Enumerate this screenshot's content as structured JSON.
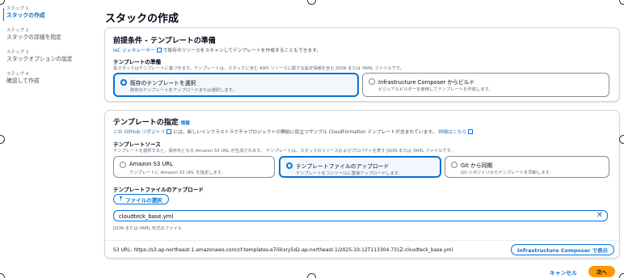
{
  "sidebar": {
    "steps": [
      {
        "num": "ステップ 1",
        "label": "スタックの作成"
      },
      {
        "num": "ステップ 2",
        "label": "スタックの詳細を指定"
      },
      {
        "num": "ステップ 3",
        "label": "スタックオプションの設定"
      },
      {
        "num": "ステップ 4",
        "label": "確認して作成"
      }
    ]
  },
  "page": {
    "title": "スタックの作成"
  },
  "prereq": {
    "title": "前提条件 - テンプレートの準備",
    "desc_link": "IaC ジェネレーター",
    "desc_rest": "で既存のリソースをスキャンしてテンプレートを作成することもできます。",
    "section_label": "テンプレートの準備",
    "section_desc": "各スタックはテンプレートに基づきます。テンプレートは、スタックに含む AWS リソースに関する設定情報を含む JSON または YAML ファイルです。",
    "options": [
      {
        "title": "既存のテンプレートを選択",
        "desc": "既存のテンプレートをアップロードまたは選択します。"
      },
      {
        "title": "Infrastructure Composer からビルド",
        "desc": "ビジュアルビルダーを使用してテンプレートを作成します。"
      }
    ]
  },
  "template": {
    "title": "テンプレートの指定",
    "info": "情報",
    "desc_pre": "この",
    "desc_link": "GitHub リポジトリ",
    "desc_rest": "には、新しいインフラストラクチャプロジェクトの開始に役立つサンプル CloudFormation テンプレートが含まれています。",
    "desc_more": "詳細はこちら",
    "source_label": "テンプレートソース",
    "source_desc": "テンプレートを選択すると、保存先となる Amazon S3 URL が生成されます。 テンプレートは、スタックのリソースおよびプロパティを表す JSON または YAML ファイルです。",
    "sources": [
      {
        "title": "Amazon S3 URL",
        "desc": "テンプレートに Amazon S3 URL を指定します。"
      },
      {
        "title": "テンプレートファイルのアップロード",
        "desc": "テンプレートをコンソールに直接アップロードします。"
      },
      {
        "title": "Git から同期",
        "desc": "Git リポジトリからテンプレートを同期します。"
      }
    ],
    "upload_label": "テンプレートファイルのアップロード",
    "choose_file": "ファイルの選択",
    "file_name": "cloudteck_base.yml",
    "file_hint": "JSON または YAML 形式のファイル",
    "s3_url": "S3 URL:  https://s3.ap-northeast-1.amazonaws.com/cf-templates-e7ilikxry5d2-ap-northeast-1/2025-10-12T113304.731Z-cloudteck_base.yml",
    "view_composer": "Infrastructure Composer で表示"
  },
  "footer": {
    "cancel": "キャンセル",
    "next": "次へ"
  },
  "colors": {
    "accent": "#0972d3",
    "primary_button": "#ff9900"
  }
}
